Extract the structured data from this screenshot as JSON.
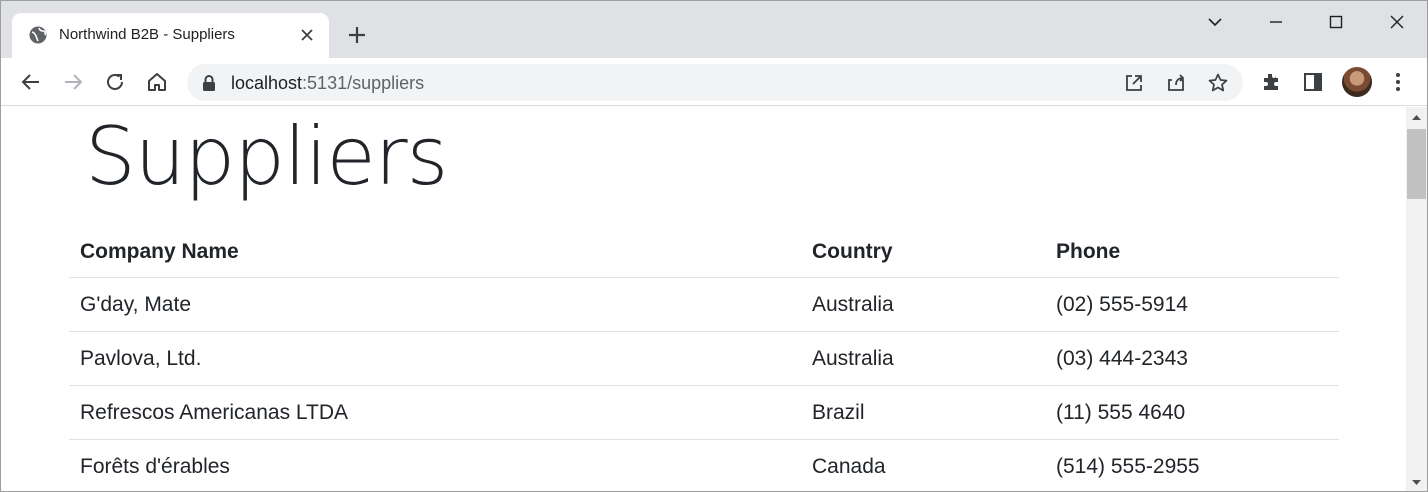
{
  "browser": {
    "tab_title": "Northwind B2B - Suppliers",
    "url_host": "localhost",
    "url_path": ":5131/suppliers",
    "icons": [
      "globe-icon",
      "close-icon",
      "plus-icon",
      "chevron-down-icon",
      "minimize-icon",
      "maximize-icon",
      "window-close-icon",
      "back-icon",
      "forward-icon",
      "reload-icon",
      "home-icon",
      "lock-icon",
      "open-in-app-icon",
      "share-icon",
      "star-icon",
      "extensions-icon",
      "side-panel-icon",
      "avatar",
      "kebab-menu-icon"
    ]
  },
  "page": {
    "title": "Suppliers",
    "table": {
      "headers": [
        "Company Name",
        "Country",
        "Phone"
      ],
      "rows": [
        [
          "G'day, Mate",
          "Australia",
          "(02) 555-5914"
        ],
        [
          "Pavlova, Ltd.",
          "Australia",
          "(03) 444-2343"
        ],
        [
          "Refrescos Americanas LTDA",
          "Brazil",
          "(11) 555 4640"
        ],
        [
          "Forêts d'érables",
          "Canada",
          "(514) 555-2955"
        ]
      ]
    }
  },
  "colors": {
    "tabstrip": "#dfe1e5",
    "omnibox": "#f1f3f4",
    "text": "#212529",
    "row_border": "#dee2e6"
  }
}
